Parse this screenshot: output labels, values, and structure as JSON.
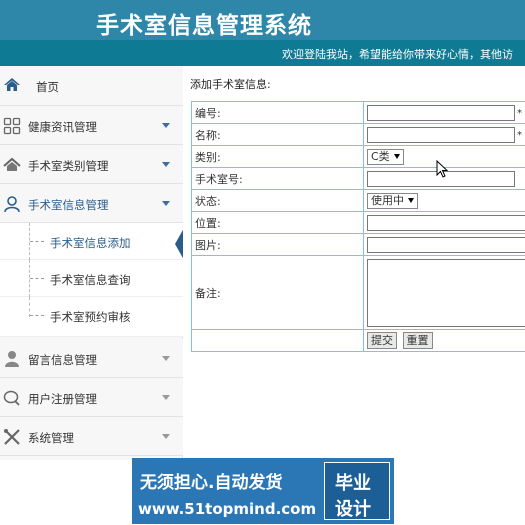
{
  "header": {
    "title": "手术室信息管理系统"
  },
  "ticker": {
    "message": "欢迎登陆我站，希望能给你带来好心情，其他访"
  },
  "sidebar": {
    "items": [
      {
        "label": "首页",
        "icon": "home-icon"
      },
      {
        "label": "健康资讯管理",
        "icon": "grid-icon"
      },
      {
        "label": "手术室类别管理",
        "icon": "house-icon"
      },
      {
        "label": "手术室信息管理",
        "icon": "user-icon"
      },
      {
        "label": "留言信息管理",
        "icon": "person-icon"
      },
      {
        "label": "用户注册管理",
        "icon": "chat-icon"
      },
      {
        "label": "系统管理",
        "icon": "wrench-icon"
      }
    ],
    "subitems": [
      {
        "label": "手术室信息添加"
      },
      {
        "label": "手术室信息查询"
      },
      {
        "label": "手术室预约审核"
      }
    ]
  },
  "form": {
    "heading": "添加手术室信息:",
    "fields": [
      {
        "label": "编号:",
        "value": "",
        "required": "*"
      },
      {
        "label": "名称:",
        "value": "",
        "required": "*"
      },
      {
        "label": "类别:",
        "value": "C类"
      },
      {
        "label": "手术室号:",
        "value": ""
      },
      {
        "label": "状态:",
        "value": "使用中"
      },
      {
        "label": "位置:",
        "value": ""
      },
      {
        "label": "图片:",
        "value": ""
      },
      {
        "label": "备注:",
        "value": ""
      }
    ],
    "submit_label": "提交",
    "reset_label": "重置"
  },
  "ad": {
    "line1": "无须担心.自动发货",
    "line2": "www.51topmind.com",
    "box_line1": "毕业",
    "box_line2": "设计"
  },
  "colors": {
    "header": "#2e86a8",
    "ticker": "#0e7a93",
    "accent": "#2a5d8c",
    "border": "#7dc3e6"
  }
}
